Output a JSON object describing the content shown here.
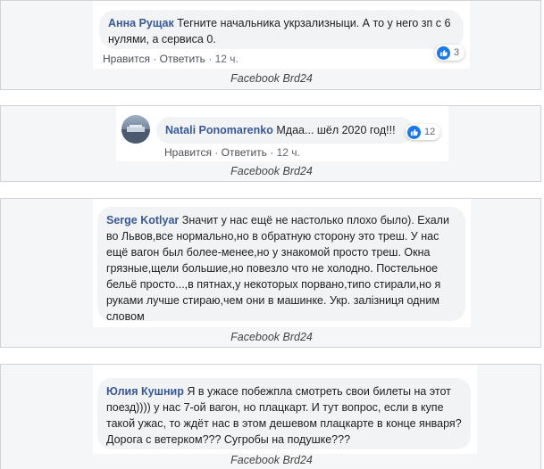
{
  "comments": [
    {
      "author": "Анна Рущак",
      "text": "Тегните начальника укрзализныци. А то у него зп с 6 нулями, а сервиса 0.",
      "like": "Нравится",
      "reply": "Ответить",
      "time": "12 ч.",
      "reactions": "3",
      "caption": "Facebook Brd24"
    },
    {
      "author": "Natali Ponomarenko",
      "text": "Мдаа... шёл 2020 год!!!",
      "like": "Нравится",
      "reply": "Ответить",
      "time": "12 ч.",
      "reactions": "12",
      "caption": "Facebook Brd24"
    },
    {
      "author": "Serge Kotlyar",
      "text": "Значит у нас ещё не настолько плохо было). Ехали во Львов,все нормально,но в обратную сторону это треш. У нас ещё вагон был более-менее,но у знакомой просто треш. Окна грязные,щели большие,но повезло что не холодно. Постельное бельё просто...,в пятнах,у некоторых порвано,типо стирали,но я руками лучше стираю,чем они в машинке. Укр. залізниця одним словом",
      "caption": "Facebook Brd24"
    },
    {
      "author": "Юлия Кушнир",
      "text": "Я в ужасе побежпла смотреть свои билеты на этот поезд)))) у нас 7-ой вагон, но плацкарт. И тут вопрос, если в купе такой ужас, то ждёт нас в этом дешевом плацкарте в конце января? Дорога с ветерком??? Сугробы на подушке???",
      "caption": "Facebook Brd24"
    }
  ],
  "icons": {
    "like": "thumbs-up-icon",
    "avatar": "user-avatar"
  },
  "colors": {
    "author": "#385898",
    "like_badge": "#1877f2"
  }
}
